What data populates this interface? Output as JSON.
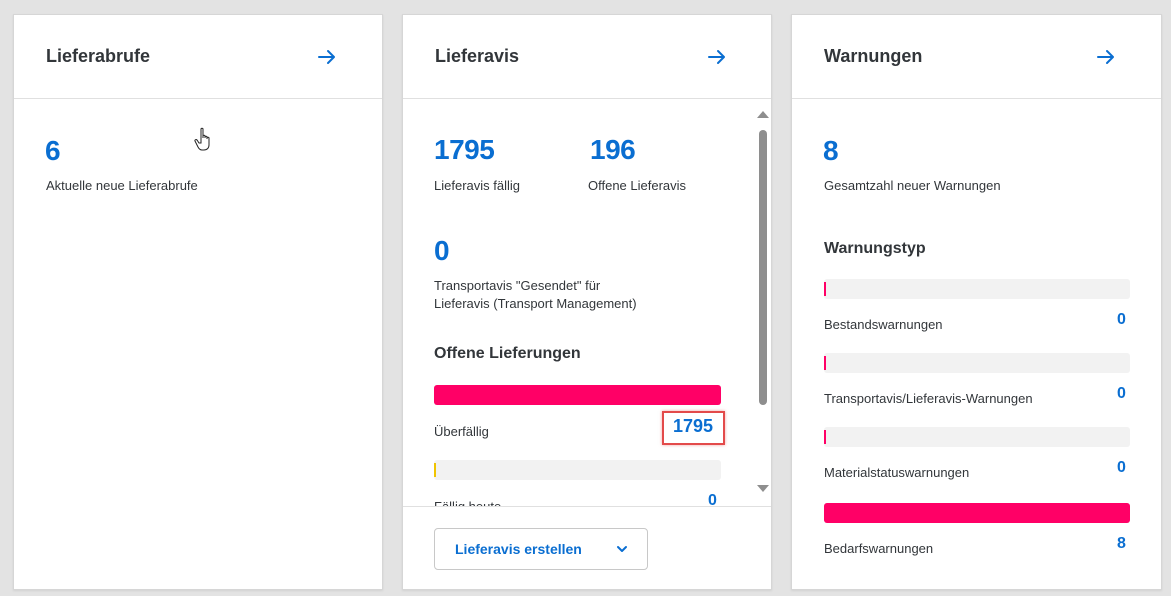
{
  "colors": {
    "accent": "#0a6ed1",
    "bar_red": "#ff0066",
    "bar_yellow": "#f0c400",
    "track": "#f2f2f2",
    "highlight": "#e34a4a"
  },
  "cards": {
    "lieferabrufe": {
      "title": "Lieferabrufe",
      "count": "6",
      "count_label": "Aktuelle neue Lieferabrufe"
    },
    "lieferavis": {
      "title": "Lieferavis",
      "faellig_value": "1795",
      "faellig_label": "Lieferavis fällig",
      "offen_value": "196",
      "offen_label": "Offene Lieferavis",
      "transport_value": "0",
      "transport_label_line1": "Transportavis \"Gesendet\" für",
      "transport_label_line2": "Lieferavis (Transport Management)",
      "section_title": "Offene Lieferungen",
      "rows": [
        {
          "label": "Überfällig",
          "value": "1795",
          "fraction": 1.0
        },
        {
          "label": "Fällig heute",
          "value": "0",
          "fraction": 0.0
        }
      ],
      "create_button": "Lieferavis erstellen"
    },
    "warnungen": {
      "title": "Warnungen",
      "count": "8",
      "count_label": "Gesamtzahl neuer Warnungen",
      "section_title": "Warnungstyp",
      "rows": [
        {
          "label": "Bestandswarnungen",
          "value": "0",
          "fraction": 0.0
        },
        {
          "label": "Transportavis/Lieferavis-Warnungen",
          "value": "0",
          "fraction": 0.0
        },
        {
          "label": "Materialstatuswarnungen",
          "value": "0",
          "fraction": 0.0
        },
        {
          "label": "Bedarfswarnungen",
          "value": "8",
          "fraction": 1.0
        }
      ]
    }
  },
  "icons": {
    "navigate": "arrow-right-icon",
    "dropdown": "chevron-down-icon",
    "cursor": "hand-pointer-icon"
  }
}
